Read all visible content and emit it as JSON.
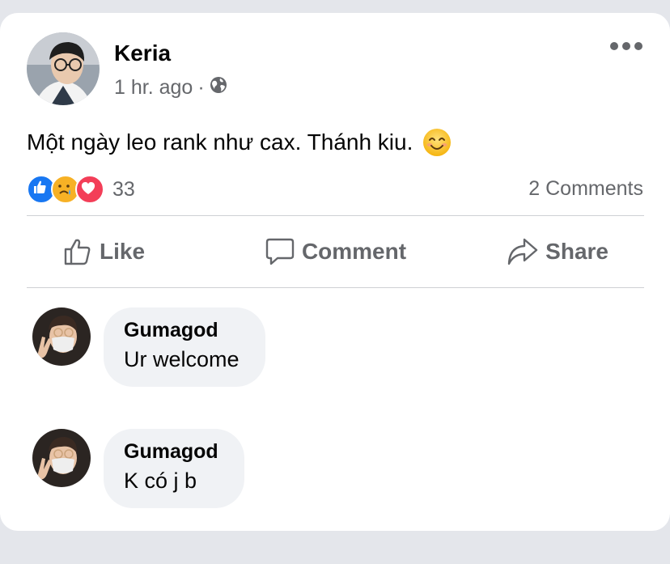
{
  "post": {
    "author": "Keria",
    "time": "1 hr. ago",
    "separator": "·",
    "audience_icon": "globe-icon",
    "text": "Một ngày leo rank như cax. Thánh kiu.",
    "emoji": "smiling-face-emoji",
    "reactions": {
      "icons": [
        "like-reaction-icon",
        "care-reaction-icon",
        "love-reaction-icon"
      ],
      "count": "33"
    },
    "comments_count": "2 Comments"
  },
  "actions": {
    "like_label": "Like",
    "comment_label": "Comment",
    "share_label": "Share"
  },
  "comments": [
    {
      "name": "Gumagod",
      "text": "Ur welcome"
    },
    {
      "name": "Gumagod",
      "text": "K có j b"
    }
  ],
  "colors": {
    "background": "#e4e6eb",
    "card": "#ffffff",
    "secondary_text": "#65676b",
    "like_blue": "#1877f2",
    "love_red": "#f33e58",
    "care_yellow": "#f7b125",
    "bubble": "#f0f2f5"
  }
}
